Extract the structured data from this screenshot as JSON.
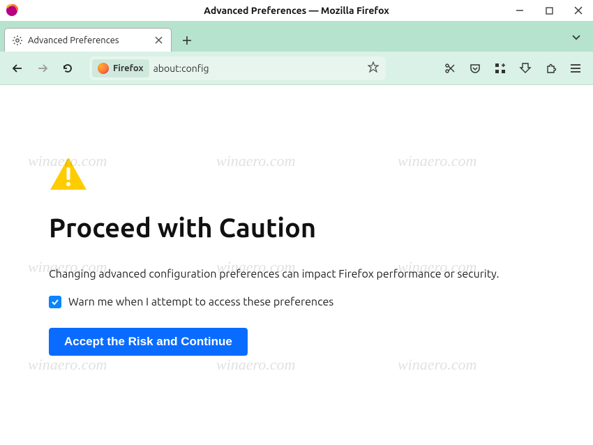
{
  "window": {
    "title": "Advanced Preferences — Mozilla Firefox"
  },
  "tab": {
    "title": "Advanced Preferences"
  },
  "urlbar": {
    "chip_label": "Firefox",
    "url": "about:config"
  },
  "page": {
    "heading": "Proceed with Caution",
    "description": "Changing advanced configuration preferences can impact Firefox performance or security.",
    "checkbox_label": "Warn me when I attempt to access these preferences",
    "accept_button": "Accept the Risk and Continue"
  },
  "watermark": "winaero.com"
}
